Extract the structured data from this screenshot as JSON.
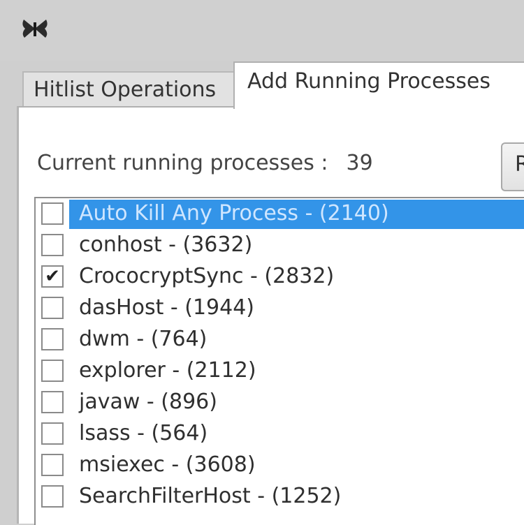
{
  "tabs": [
    {
      "label": "Hitlist Operations",
      "active": false
    },
    {
      "label": "Add Running Processes",
      "active": true
    }
  ],
  "status": {
    "label": "Current running processes :",
    "count": "39"
  },
  "refresh_button": {
    "label": "R"
  },
  "processes": [
    {
      "label": "Auto Kill Any Process - (2140)",
      "checked": false,
      "selected": true
    },
    {
      "label": "conhost - (3632)",
      "checked": false,
      "selected": false
    },
    {
      "label": "CrococryptSync - (2832)",
      "checked": true,
      "selected": false
    },
    {
      "label": "dasHost - (1944)",
      "checked": false,
      "selected": false
    },
    {
      "label": "dwm - (764)",
      "checked": false,
      "selected": false
    },
    {
      "label": "explorer - (2112)",
      "checked": false,
      "selected": false
    },
    {
      "label": "javaw - (896)",
      "checked": false,
      "selected": false
    },
    {
      "label": "lsass - (564)",
      "checked": false,
      "selected": false
    },
    {
      "label": "msiexec - (3608)",
      "checked": false,
      "selected": false
    },
    {
      "label": "SearchFilterHost - (1252)",
      "checked": false,
      "selected": false
    }
  ],
  "colors": {
    "selection": "#3394e8",
    "window_bg": "#cfcfcf"
  },
  "icons": {
    "app": "butterfly-icon",
    "check": "checkmark-icon"
  }
}
